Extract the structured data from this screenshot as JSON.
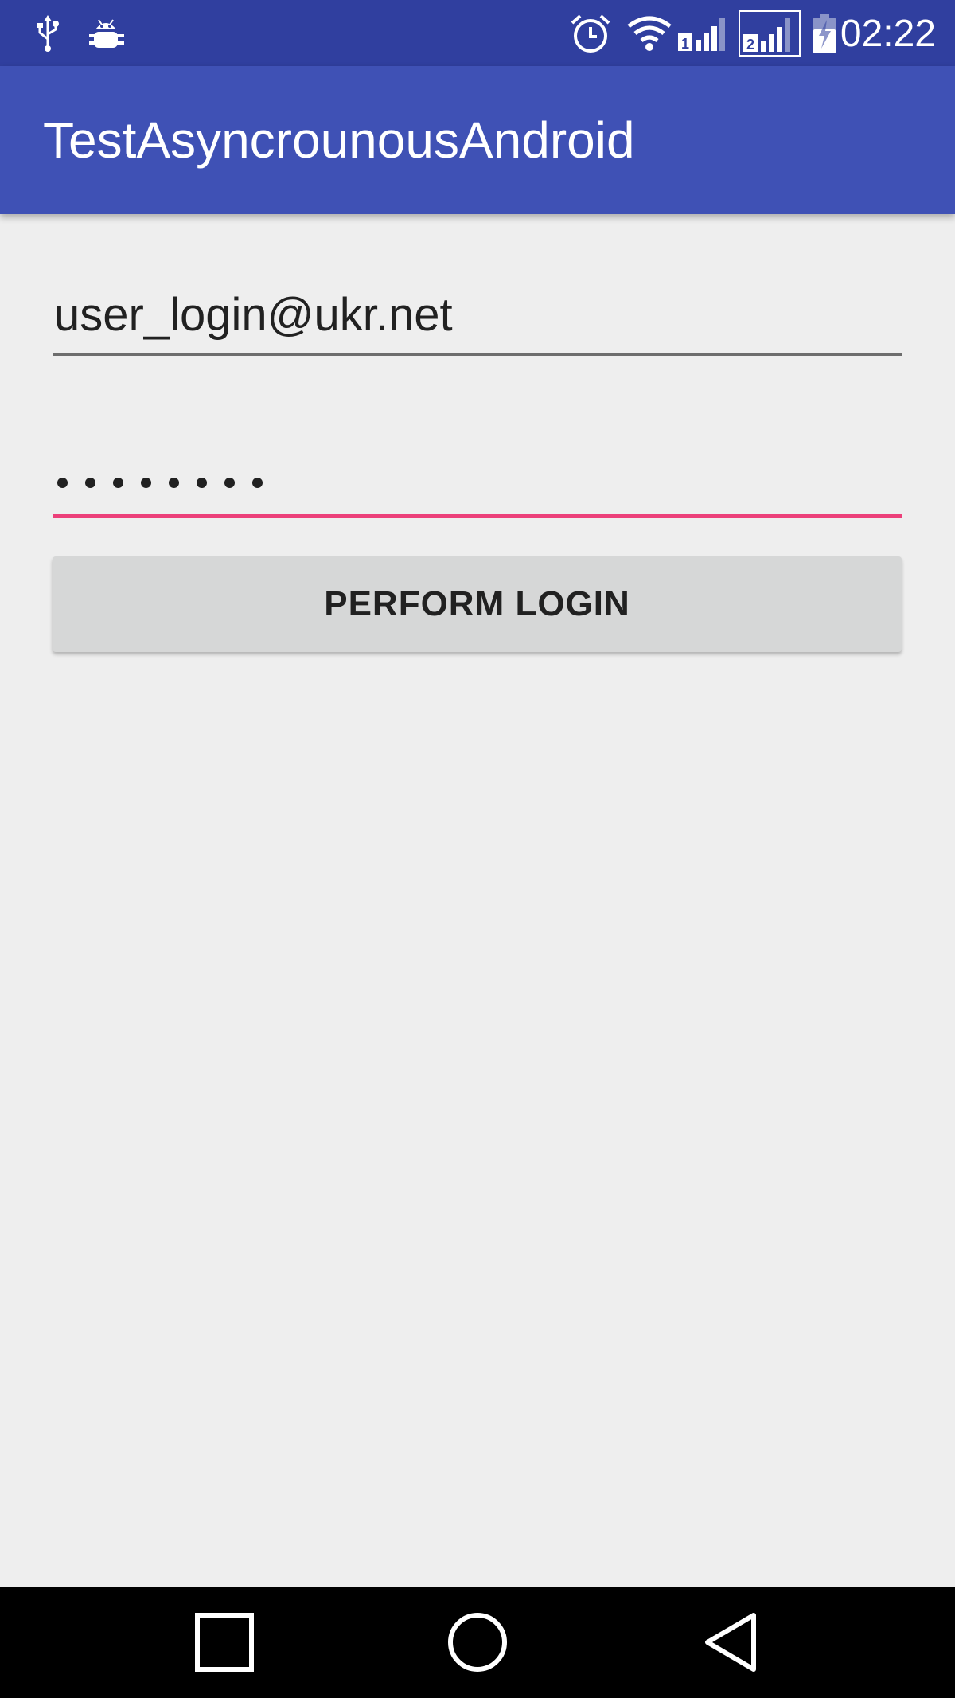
{
  "status_bar": {
    "time": "02:22",
    "left_icons": [
      "usb-icon",
      "android-debug-icon"
    ],
    "right_icons": [
      "alarm-icon",
      "wifi-icon",
      "signal-sim1-icon",
      "signal-sim2-icon",
      "battery-charging-icon"
    ],
    "sim1_label": "1",
    "sim2_label": "2"
  },
  "app_bar": {
    "title": "TestAsyncrounousAndroid"
  },
  "form": {
    "email_value": "user_login@ukr.net",
    "password_masked": "••••••••",
    "password_length": 8,
    "login_button_label": "PERFORM LOGIN"
  },
  "nav_bar": {
    "buttons": [
      "recents-icon",
      "home-icon",
      "back-icon"
    ]
  },
  "colors": {
    "status_bar": "#303f9f",
    "app_bar": "#3f51b5",
    "accent": "#ec407a",
    "background": "#eeeeee",
    "button": "#d6d7d7"
  }
}
